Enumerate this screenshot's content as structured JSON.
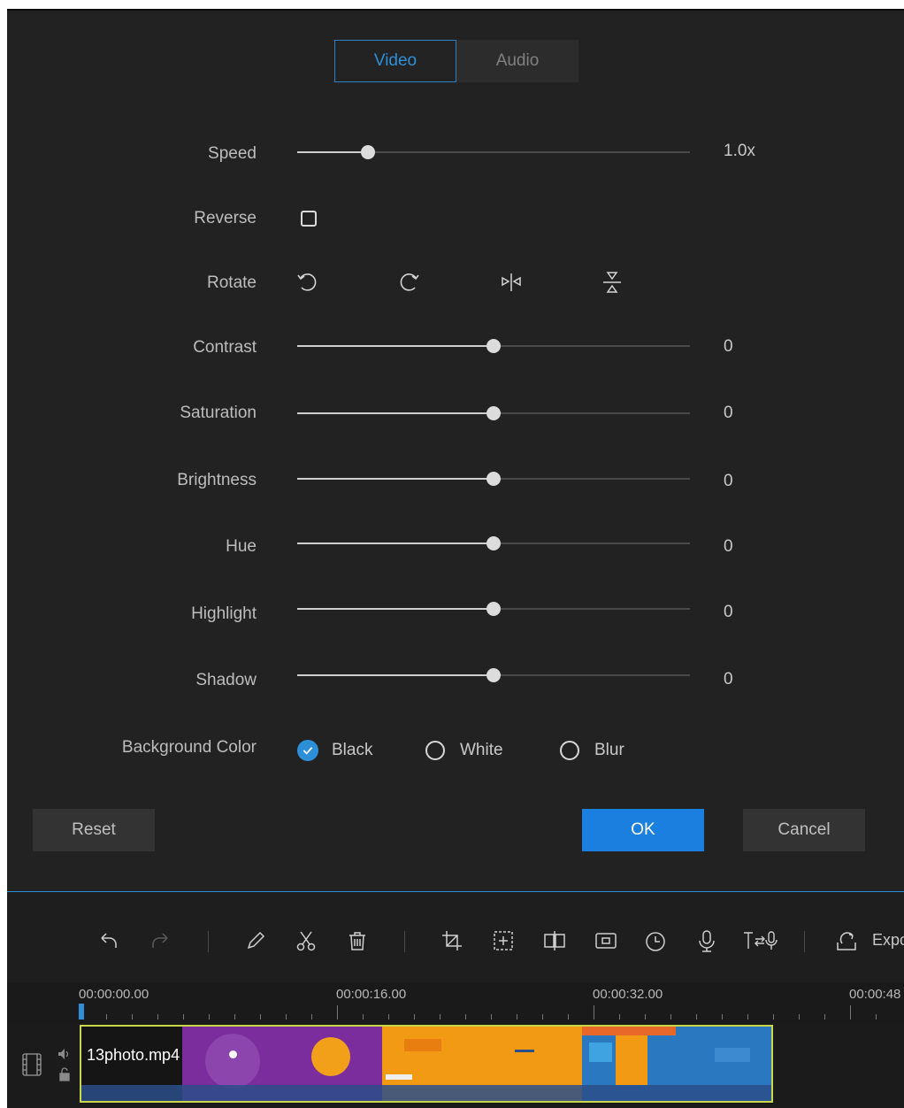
{
  "tabs": {
    "video": "Video",
    "audio": "Audio",
    "active": "video"
  },
  "speed": {
    "label": "Speed",
    "value_text": "1.0x",
    "fraction": 0.18
  },
  "reverse": {
    "label": "Reverse",
    "checked": false
  },
  "rotate": {
    "label": "Rotate",
    "icons": [
      "rotate-left-icon",
      "rotate-right-icon",
      "flip-horizontal-icon",
      "flip-vertical-icon"
    ]
  },
  "adjustments": [
    {
      "key": "contrast",
      "label": "Contrast",
      "value": "0",
      "fraction": 0.5
    },
    {
      "key": "saturation",
      "label": "Saturation",
      "value": "0",
      "fraction": 0.5
    },
    {
      "key": "brightness",
      "label": "Brightness",
      "value": "0",
      "fraction": 0.5
    },
    {
      "key": "hue",
      "label": "Hue",
      "value": "0",
      "fraction": 0.5
    },
    {
      "key": "highlight",
      "label": "Highlight",
      "value": "0",
      "fraction": 0.5
    },
    {
      "key": "shadow",
      "label": "Shadow",
      "value": "0",
      "fraction": 0.5
    }
  ],
  "background_color": {
    "label": "Background Color",
    "options": [
      "Black",
      "White",
      "Blur"
    ],
    "selected": "Black"
  },
  "buttons": {
    "reset": "Reset",
    "ok": "OK",
    "cancel": "Cancel"
  },
  "toolbar": {
    "icons": [
      "undo-icon",
      "redo-icon",
      "edit-icon",
      "cut-icon",
      "delete-icon",
      "crop-icon",
      "resize-icon",
      "split-icon",
      "freeze-frame-icon",
      "duration-icon",
      "voiceover-icon",
      "text-to-speech-icon",
      "export-icon"
    ],
    "export_label": "Expo"
  },
  "timeline": {
    "timestamps": [
      "00:00:00.00",
      "00:00:16.00",
      "00:00:32.00",
      "00:00:48"
    ],
    "clip_name": "13photo.mp4"
  },
  "colors": {
    "accent": "#2e8fd9",
    "ok_button": "#1b7fe0",
    "panel": "#222222",
    "clip_border": "#c9d84a"
  }
}
